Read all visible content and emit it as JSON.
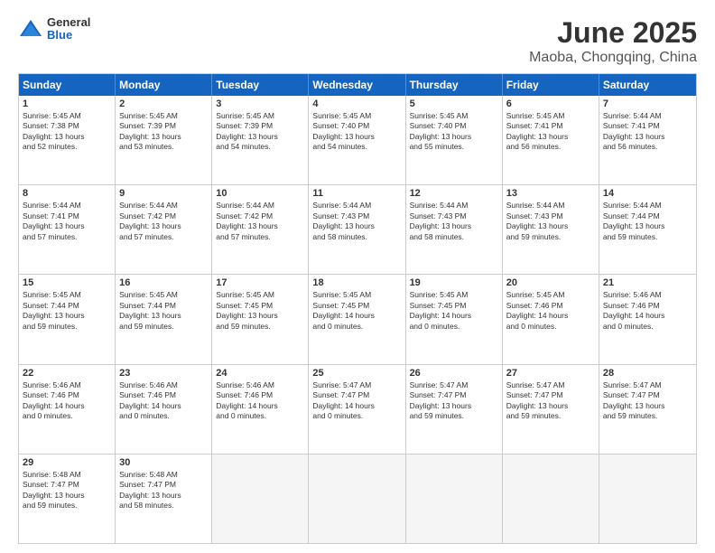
{
  "logo": {
    "general": "General",
    "blue": "Blue"
  },
  "title": "June 2025",
  "location": "Maoba, Chongqing, China",
  "days": [
    "Sunday",
    "Monday",
    "Tuesday",
    "Wednesday",
    "Thursday",
    "Friday",
    "Saturday"
  ],
  "weeks": [
    [
      {
        "num": "1",
        "lines": [
          "Sunrise: 5:45 AM",
          "Sunset: 7:38 PM",
          "Daylight: 13 hours",
          "and 52 minutes."
        ]
      },
      {
        "num": "2",
        "lines": [
          "Sunrise: 5:45 AM",
          "Sunset: 7:39 PM",
          "Daylight: 13 hours",
          "and 53 minutes."
        ]
      },
      {
        "num": "3",
        "lines": [
          "Sunrise: 5:45 AM",
          "Sunset: 7:39 PM",
          "Daylight: 13 hours",
          "and 54 minutes."
        ]
      },
      {
        "num": "4",
        "lines": [
          "Sunrise: 5:45 AM",
          "Sunset: 7:40 PM",
          "Daylight: 13 hours",
          "and 54 minutes."
        ]
      },
      {
        "num": "5",
        "lines": [
          "Sunrise: 5:45 AM",
          "Sunset: 7:40 PM",
          "Daylight: 13 hours",
          "and 55 minutes."
        ]
      },
      {
        "num": "6",
        "lines": [
          "Sunrise: 5:45 AM",
          "Sunset: 7:41 PM",
          "Daylight: 13 hours",
          "and 56 minutes."
        ]
      },
      {
        "num": "7",
        "lines": [
          "Sunrise: 5:44 AM",
          "Sunset: 7:41 PM",
          "Daylight: 13 hours",
          "and 56 minutes."
        ]
      }
    ],
    [
      {
        "num": "8",
        "lines": [
          "Sunrise: 5:44 AM",
          "Sunset: 7:41 PM",
          "Daylight: 13 hours",
          "and 57 minutes."
        ]
      },
      {
        "num": "9",
        "lines": [
          "Sunrise: 5:44 AM",
          "Sunset: 7:42 PM",
          "Daylight: 13 hours",
          "and 57 minutes."
        ]
      },
      {
        "num": "10",
        "lines": [
          "Sunrise: 5:44 AM",
          "Sunset: 7:42 PM",
          "Daylight: 13 hours",
          "and 57 minutes."
        ]
      },
      {
        "num": "11",
        "lines": [
          "Sunrise: 5:44 AM",
          "Sunset: 7:43 PM",
          "Daylight: 13 hours",
          "and 58 minutes."
        ]
      },
      {
        "num": "12",
        "lines": [
          "Sunrise: 5:44 AM",
          "Sunset: 7:43 PM",
          "Daylight: 13 hours",
          "and 58 minutes."
        ]
      },
      {
        "num": "13",
        "lines": [
          "Sunrise: 5:44 AM",
          "Sunset: 7:43 PM",
          "Daylight: 13 hours",
          "and 59 minutes."
        ]
      },
      {
        "num": "14",
        "lines": [
          "Sunrise: 5:44 AM",
          "Sunset: 7:44 PM",
          "Daylight: 13 hours",
          "and 59 minutes."
        ]
      }
    ],
    [
      {
        "num": "15",
        "lines": [
          "Sunrise: 5:45 AM",
          "Sunset: 7:44 PM",
          "Daylight: 13 hours",
          "and 59 minutes."
        ]
      },
      {
        "num": "16",
        "lines": [
          "Sunrise: 5:45 AM",
          "Sunset: 7:44 PM",
          "Daylight: 13 hours",
          "and 59 minutes."
        ]
      },
      {
        "num": "17",
        "lines": [
          "Sunrise: 5:45 AM",
          "Sunset: 7:45 PM",
          "Daylight: 13 hours",
          "and 59 minutes."
        ]
      },
      {
        "num": "18",
        "lines": [
          "Sunrise: 5:45 AM",
          "Sunset: 7:45 PM",
          "Daylight: 14 hours",
          "and 0 minutes."
        ]
      },
      {
        "num": "19",
        "lines": [
          "Sunrise: 5:45 AM",
          "Sunset: 7:45 PM",
          "Daylight: 14 hours",
          "and 0 minutes."
        ]
      },
      {
        "num": "20",
        "lines": [
          "Sunrise: 5:45 AM",
          "Sunset: 7:46 PM",
          "Daylight: 14 hours",
          "and 0 minutes."
        ]
      },
      {
        "num": "21",
        "lines": [
          "Sunrise: 5:46 AM",
          "Sunset: 7:46 PM",
          "Daylight: 14 hours",
          "and 0 minutes."
        ]
      }
    ],
    [
      {
        "num": "22",
        "lines": [
          "Sunrise: 5:46 AM",
          "Sunset: 7:46 PM",
          "Daylight: 14 hours",
          "and 0 minutes."
        ]
      },
      {
        "num": "23",
        "lines": [
          "Sunrise: 5:46 AM",
          "Sunset: 7:46 PM",
          "Daylight: 14 hours",
          "and 0 minutes."
        ]
      },
      {
        "num": "24",
        "lines": [
          "Sunrise: 5:46 AM",
          "Sunset: 7:46 PM",
          "Daylight: 14 hours",
          "and 0 minutes."
        ]
      },
      {
        "num": "25",
        "lines": [
          "Sunrise: 5:47 AM",
          "Sunset: 7:47 PM",
          "Daylight: 14 hours",
          "and 0 minutes."
        ]
      },
      {
        "num": "26",
        "lines": [
          "Sunrise: 5:47 AM",
          "Sunset: 7:47 PM",
          "Daylight: 13 hours",
          "and 59 minutes."
        ]
      },
      {
        "num": "27",
        "lines": [
          "Sunrise: 5:47 AM",
          "Sunset: 7:47 PM",
          "Daylight: 13 hours",
          "and 59 minutes."
        ]
      },
      {
        "num": "28",
        "lines": [
          "Sunrise: 5:47 AM",
          "Sunset: 7:47 PM",
          "Daylight: 13 hours",
          "and 59 minutes."
        ]
      }
    ],
    [
      {
        "num": "29",
        "lines": [
          "Sunrise: 5:48 AM",
          "Sunset: 7:47 PM",
          "Daylight: 13 hours",
          "and 59 minutes."
        ]
      },
      {
        "num": "30",
        "lines": [
          "Sunrise: 5:48 AM",
          "Sunset: 7:47 PM",
          "Daylight: 13 hours",
          "and 58 minutes."
        ]
      },
      {
        "num": "",
        "lines": []
      },
      {
        "num": "",
        "lines": []
      },
      {
        "num": "",
        "lines": []
      },
      {
        "num": "",
        "lines": []
      },
      {
        "num": "",
        "lines": []
      }
    ]
  ]
}
